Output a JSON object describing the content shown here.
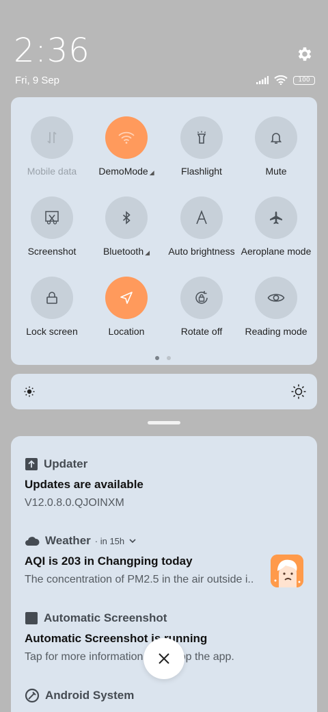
{
  "status": {
    "time": "2:36",
    "date": "Fri, 9 Sep",
    "battery": "100"
  },
  "quick_settings": {
    "tiles": [
      {
        "label": "Mobile data",
        "active": false,
        "icon": "mobile-data-icon"
      },
      {
        "label": "DemoMode",
        "active": true,
        "icon": "wifi-icon"
      },
      {
        "label": "Flashlight",
        "active": false,
        "icon": "flashlight-icon"
      },
      {
        "label": "Mute",
        "active": false,
        "icon": "bell-icon"
      },
      {
        "label": "Screenshot",
        "active": false,
        "icon": "screenshot-icon"
      },
      {
        "label": "Bluetooth",
        "active": false,
        "icon": "bluetooth-icon"
      },
      {
        "label": "Auto brightness",
        "active": false,
        "icon": "auto-brightness-icon"
      },
      {
        "label": "Aeroplane mode",
        "active": false,
        "icon": "airplane-icon"
      },
      {
        "label": "Lock screen",
        "active": false,
        "icon": "lock-icon"
      },
      {
        "label": "Location",
        "active": true,
        "icon": "location-icon"
      },
      {
        "label": "Rotate off",
        "active": false,
        "icon": "rotate-icon"
      },
      {
        "label": "Reading mode",
        "active": false,
        "icon": "eye-icon"
      }
    ],
    "page_index": 1,
    "page_count": 2
  },
  "brightness": {
    "level": 0.0
  },
  "notifications": [
    {
      "app": "Updater",
      "title": "Updates are available",
      "body": "V12.0.8.0.QJOINXM"
    },
    {
      "app": "Weather",
      "time": "in 15h",
      "title": "AQI is 203 in Changping today",
      "body": "The concentration of PM2.5 in the air outside i.."
    },
    {
      "app": "Automatic Screenshot",
      "title": "Automatic Screenshot is running",
      "body": "Tap for more information or to stop the app."
    },
    {
      "app": "Android System"
    }
  ],
  "colors": {
    "accent": "#ff9a5c",
    "panel": "#dbe4ee",
    "tile_inactive": "#c7d0d9"
  }
}
